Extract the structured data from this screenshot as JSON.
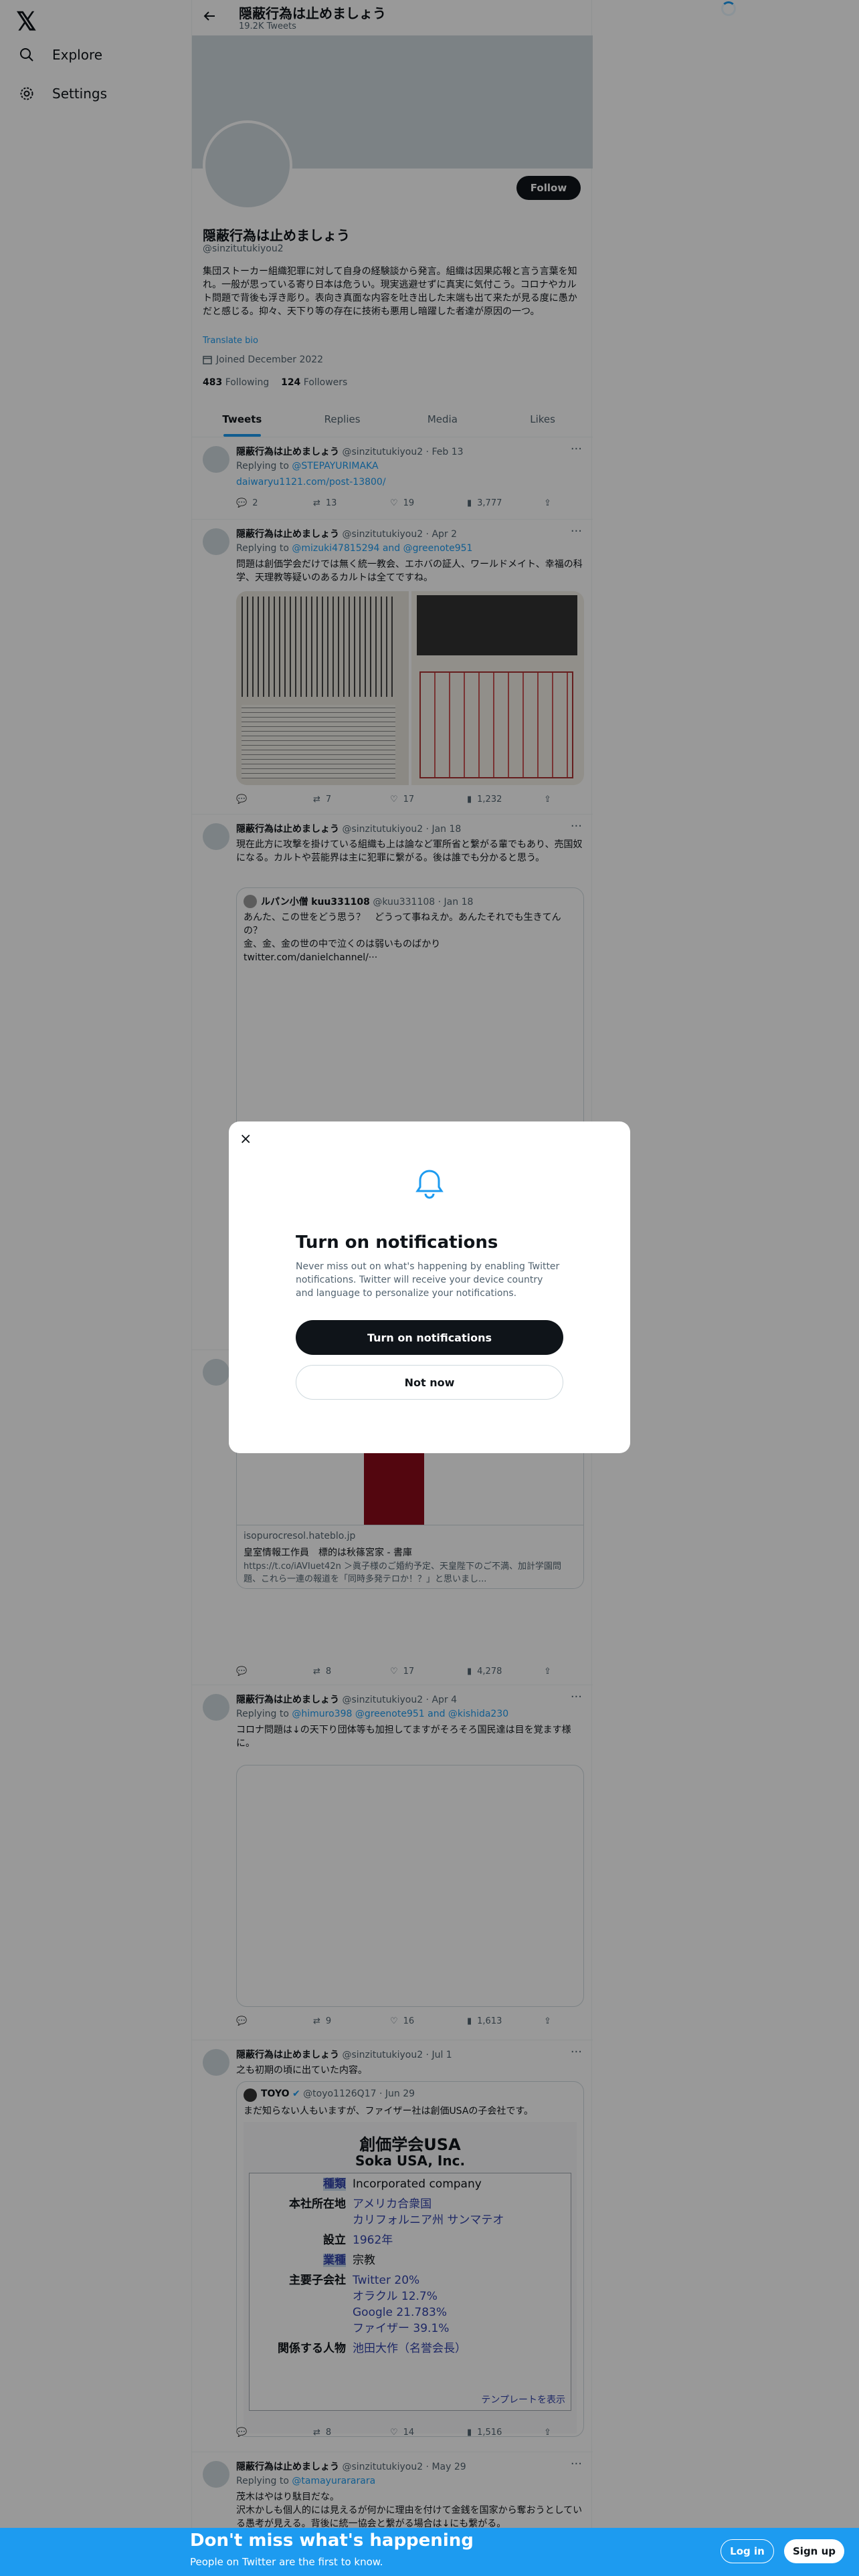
{
  "nav": {
    "logo": "𝕏",
    "explore": "Explore",
    "settings": "Settings"
  },
  "header": {
    "title": "隠蔽行為は止めましょう",
    "tweets_count": "19.2K Tweets"
  },
  "profile": {
    "name": "隠蔽行為は止めましょう",
    "handle": "@sinzitutukiyou2",
    "follow": "Follow",
    "bio": "集団ストーカー組織犯罪に対して自身の経験談から発言。組織は因果応報と言う言葉を知れ。一般が思っている寄り日本は危うい。現実逃避せずに真実に気付こう。コロナやカルト問題で背後も浮き彫り。表向き真面な内容を吐き出した末端も出て来たが見る度に愚かだと感じる。抑々、天下り等の存在に技術も悪用し暗躍した者達が原因の一つ。",
    "translate": "Translate bio",
    "joined": "Joined December 2022",
    "following_count": "483",
    "following_label": "Following",
    "followers_count": "124",
    "followers_label": "Followers"
  },
  "tabs": [
    "Tweets",
    "Replies",
    "Media",
    "Likes"
  ],
  "tweets": [
    {
      "name": "隠蔽行為は止めましょう",
      "handle": "@sinzitutukiyou2",
      "date": "Feb 13",
      "replying_label": "Replying to",
      "reply_to": "@STEPAYURIMAKA",
      "text": "daiwaryu1121.com/post-13800/",
      "replies": "2",
      "retweets": "13",
      "likes": "19",
      "views": "3,777"
    },
    {
      "name": "隠蔽行為は止めましょう",
      "handle": "@sinzitutukiyou2",
      "date": "Apr 2",
      "replying_label": "Replying to",
      "reply_to": "@mizuki47815294 and @greenote951",
      "text": "問題は創価学会だけでは無く統一教会、エホバの証人、ワールドメイト、幸福の科学、天理教等疑いのあるカルトは全てですね。",
      "replies": "",
      "retweets": "7",
      "likes": "17",
      "views": "1,232"
    },
    {
      "name": "隠蔽行為は止めましょう",
      "handle": "@sinzitutukiyou2",
      "date": "Jan 18",
      "text": "現在此方に攻撃を掛けている組織も上は論など軍所省と繋がる輩でもあり、売国奴になる。カルトや芸能界は主に犯罪に繋がる。後は誰でも分かると思う。",
      "quote": {
        "name": "ルパン小僧",
        "name2": "kuu331108",
        "handle": "@kuu331108",
        "date": "Jan 18",
        "text": "あんた、この世をどう思う？　どうって事ねえか。あんたそれでも生きてんの？\n金、金、金の世の中で泣くのは弱いものばかり\ntwitter.com/danielchannel/···"
      }
    },
    {
      "card_domain": "isopurocresol.hateblo.jp",
      "card_title": "皇室情報工作員　標的は秋篠宮家 - 書庫",
      "card_desc": "https://t.co/iAVIuet42n ＞眞子様のご婚約予定、天皇陛下のご不満、加計学園問題、これら一連の報道を「同時多発テロか！？」と思いまし...",
      "replies": "",
      "retweets": "8",
      "likes": "17",
      "views": "4,278"
    },
    {
      "name": "隠蔽行為は止めましょう",
      "handle": "@sinzitutukiyou2",
      "date": "Apr 4",
      "replying_label": "Replying to",
      "reply_to": "@himuro398 @greenote951 and @kishida230",
      "text": "コロナ問題は↓の天下り団体等も加担してますがそろそろ国民達は目を覚ます様に。",
      "replies": "",
      "retweets": "9",
      "likes": "16",
      "views": "1,613"
    },
    {
      "name": "隠蔽行為は止めましょう",
      "handle": "@sinzitutukiyou2",
      "date": "Jul 1",
      "text": "之も初期の頃に出ていた内容。",
      "quote": {
        "name": "TOYO",
        "handle": "@toyo1126Q17",
        "date": "Jun 29",
        "text": "まだ知らない人もいますが、ファイザー社は創価USAの子会社です。"
      },
      "infobox": {
        "title": "創価学会USA",
        "subtitle": "Soka USA, Inc.",
        "rows": [
          {
            "k": "種類",
            "v": "Incorporated company"
          },
          {
            "k": "本社所在地",
            "v": "アメリカ合衆国\nカリフォルニア州 サンマテオ"
          },
          {
            "k": "設立",
            "v": "1962年"
          },
          {
            "k": "業種",
            "v": "宗教"
          },
          {
            "k": "主要子会社",
            "v": "Twitter 20%\nオラクル 12.7%\nGoogle 21.783%\nファイザー 39.1%"
          },
          {
            "k": "関係する人物",
            "v": "池田大作（名誉会長）"
          }
        ],
        "footer": "テンプレートを表示"
      },
      "replies": "",
      "retweets": "8",
      "likes": "14",
      "views": "1,516"
    },
    {
      "name": "隠蔽行為は止めましょう",
      "handle": "@sinzitutukiyou2",
      "date": "May 29",
      "replying_label": "Replying to",
      "reply_to": "@tamayurararara",
      "text": "茂木はやはり駄目だな。\n沢木かしも個人的には見えるが何かに理由を付けて金銭を国家から奪おうとしている愚考が見える。背後に統一協会と繋がる場合は↓にも繋がる。"
    }
  ],
  "modal": {
    "close": "×",
    "title": "Turn on notifications",
    "text": "Never miss out on what's happening by enabling Twitter notifications. Twitter will receive your device country and language to personalize your notifications.",
    "primary": "Turn on notifications",
    "secondary": "Not now"
  },
  "bottom": {
    "title": "Don't miss what's happening",
    "subtitle": "People on Twitter are the first to know.",
    "login": "Log in",
    "signup": "Sign up"
  }
}
